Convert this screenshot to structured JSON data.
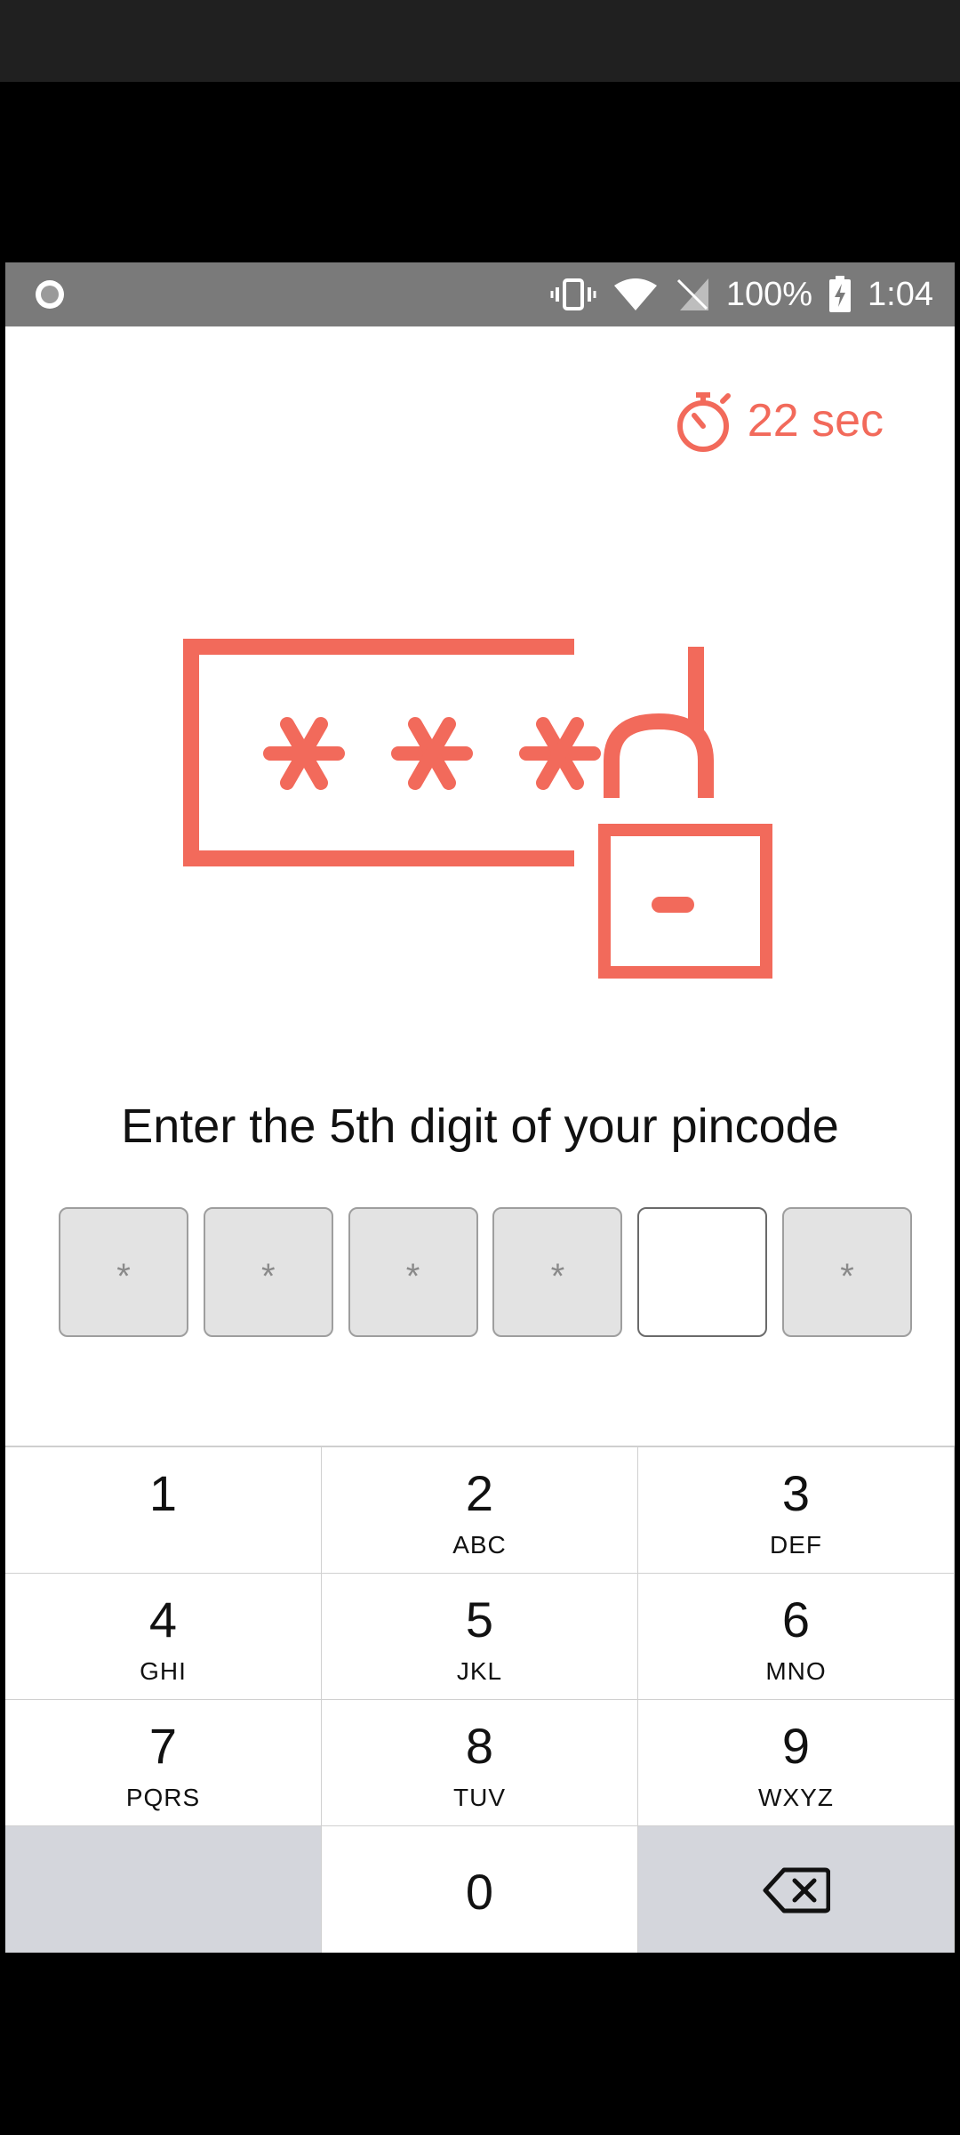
{
  "status_bar": {
    "battery": "100%",
    "time": "1:04",
    "icons": [
      "record-indicator-icon",
      "vibrate-icon",
      "wifi-icon",
      "no-sim-icon",
      "battery-charging-icon"
    ]
  },
  "timer": {
    "label": "22 sec",
    "icon": "stopwatch-icon"
  },
  "illustration": {
    "icon": "password-lock-illustration",
    "color": "#f26a5b"
  },
  "prompt": "Enter the 5th digit of your pincode",
  "pin": {
    "mask": "*",
    "slots": [
      {
        "value": "*",
        "active": false
      },
      {
        "value": "*",
        "active": false
      },
      {
        "value": "*",
        "active": false
      },
      {
        "value": "*",
        "active": false
      },
      {
        "value": "",
        "active": true
      },
      {
        "value": "*",
        "active": false
      }
    ]
  },
  "keypad": {
    "keys": [
      {
        "digit": "1",
        "letters": ""
      },
      {
        "digit": "2",
        "letters": "ABC"
      },
      {
        "digit": "3",
        "letters": "DEF"
      },
      {
        "digit": "4",
        "letters": "GHI"
      },
      {
        "digit": "5",
        "letters": "JKL"
      },
      {
        "digit": "6",
        "letters": "MNO"
      },
      {
        "digit": "7",
        "letters": "PQRS"
      },
      {
        "digit": "8",
        "letters": "TUV"
      },
      {
        "digit": "9",
        "letters": "WXYZ"
      },
      {
        "digit": "0",
        "letters": ""
      }
    ],
    "backspace_icon": "backspace-icon"
  }
}
